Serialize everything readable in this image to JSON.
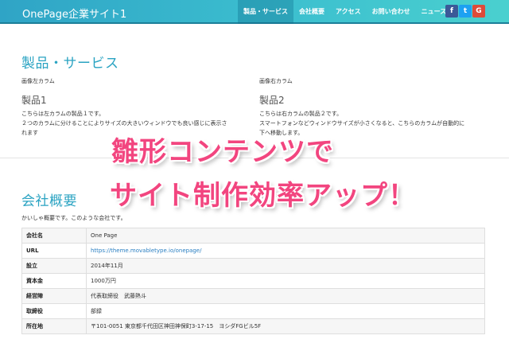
{
  "navbar": {
    "brand": "OnePage企業サイト1",
    "items": [
      {
        "label": "製品・サービス"
      },
      {
        "label": "会社概要"
      },
      {
        "label": "アクセス"
      },
      {
        "label": "お問い合わせ"
      },
      {
        "label": "ニュース"
      }
    ],
    "social": {
      "facebook": "f",
      "twitter": "t",
      "google": "G"
    },
    "colors": {
      "bar": "#3bb5cc",
      "facebook": "#3b5998",
      "twitter": "#1da1f2",
      "google": "#dd4b39"
    }
  },
  "products": {
    "title": "製品・サービス",
    "left": {
      "caption": "画像左カラム",
      "heading": "製品1",
      "line1": "こちらは左カラムの製品１です。",
      "line2": "２つのカラムに分けることによりサイズの大きいウィンドウでも良い感じに表示さ",
      "line3": "れます"
    },
    "right": {
      "caption": "画像右カラム",
      "heading": "製品2",
      "line1": "こちらは右カラムの製品２です。",
      "line2": "スマートフォンなどウィンドウサイズが小さくなると、こちらのカラムが自動的に",
      "line3": "下へ移動します。"
    }
  },
  "company": {
    "title": "会社概要",
    "intro": "かいしゃ概要です。このような会社です。",
    "rows": [
      {
        "key": "会社名",
        "value": "One Page"
      },
      {
        "key": "URL",
        "value": "https://theme.movabletype.io/onepage/"
      },
      {
        "key": "設立",
        "value": "2014年11月"
      },
      {
        "key": "資本金",
        "value": "1000万円"
      },
      {
        "key": "経営陣",
        "value": "代表取締役　武藤熱斗"
      },
      {
        "key": "取締役",
        "value": "部録"
      },
      {
        "key": "所在地",
        "value": "〒101-0051 東京都千代田区神田神保町3-17-15　ヨシダFGビル5F"
      }
    ]
  },
  "overlay": {
    "line1": "雛形コンテンツで",
    "line2": "サイト制作効率アップ！",
    "color": "#f2457f"
  }
}
